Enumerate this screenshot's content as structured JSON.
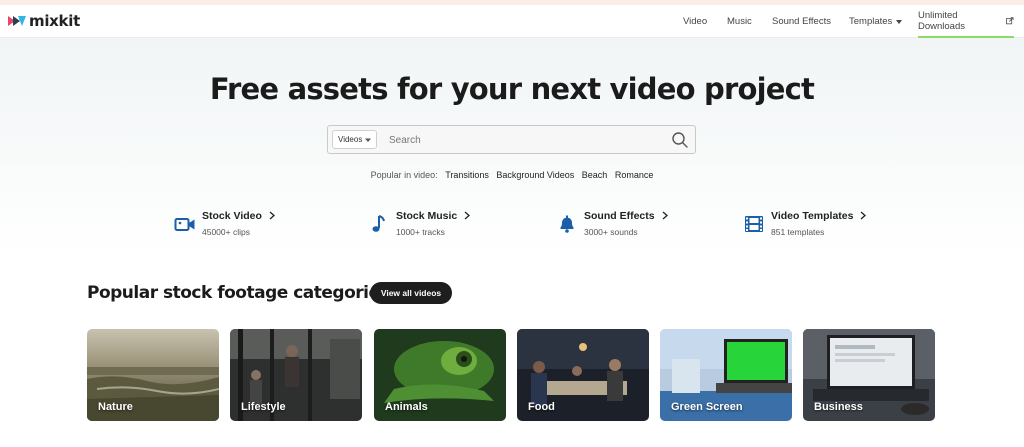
{
  "brand": {
    "name": "mixkit"
  },
  "nav": {
    "items": [
      {
        "label": "Video"
      },
      {
        "label": "Music"
      },
      {
        "label": "Sound Effects"
      },
      {
        "label": "Templates"
      },
      {
        "label": "Unlimited Downloads"
      }
    ]
  },
  "hero": {
    "title": "Free assets for your next video project"
  },
  "search": {
    "category": "Videos",
    "placeholder": "Search",
    "value": ""
  },
  "popular": {
    "label": "Popular in video:",
    "links": [
      "Transitions",
      "Background Videos",
      "Beach",
      "Romance"
    ]
  },
  "assets": [
    {
      "name": "Stock Video",
      "sub": "45000+ clips",
      "icon": "video-camera-icon"
    },
    {
      "name": "Stock Music",
      "sub": "1000+ tracks",
      "icon": "music-note-icon"
    },
    {
      "name": "Sound Effects",
      "sub": "3000+ sounds",
      "icon": "bell-icon"
    },
    {
      "name": "Video Templates",
      "sub": "851 templates",
      "icon": "film-strip-icon"
    }
  ],
  "categories": {
    "title": "Popular stock footage categories",
    "view_all": "View all videos",
    "items": [
      {
        "label": "Nature"
      },
      {
        "label": "Lifestyle"
      },
      {
        "label": "Animals"
      },
      {
        "label": "Food"
      },
      {
        "label": "Green Screen"
      },
      {
        "label": "Business"
      }
    ]
  },
  "colors": {
    "accent_green": "#8fd86a",
    "icon_blue": "#1a5fa8",
    "dark_button": "#1e1e1e"
  }
}
